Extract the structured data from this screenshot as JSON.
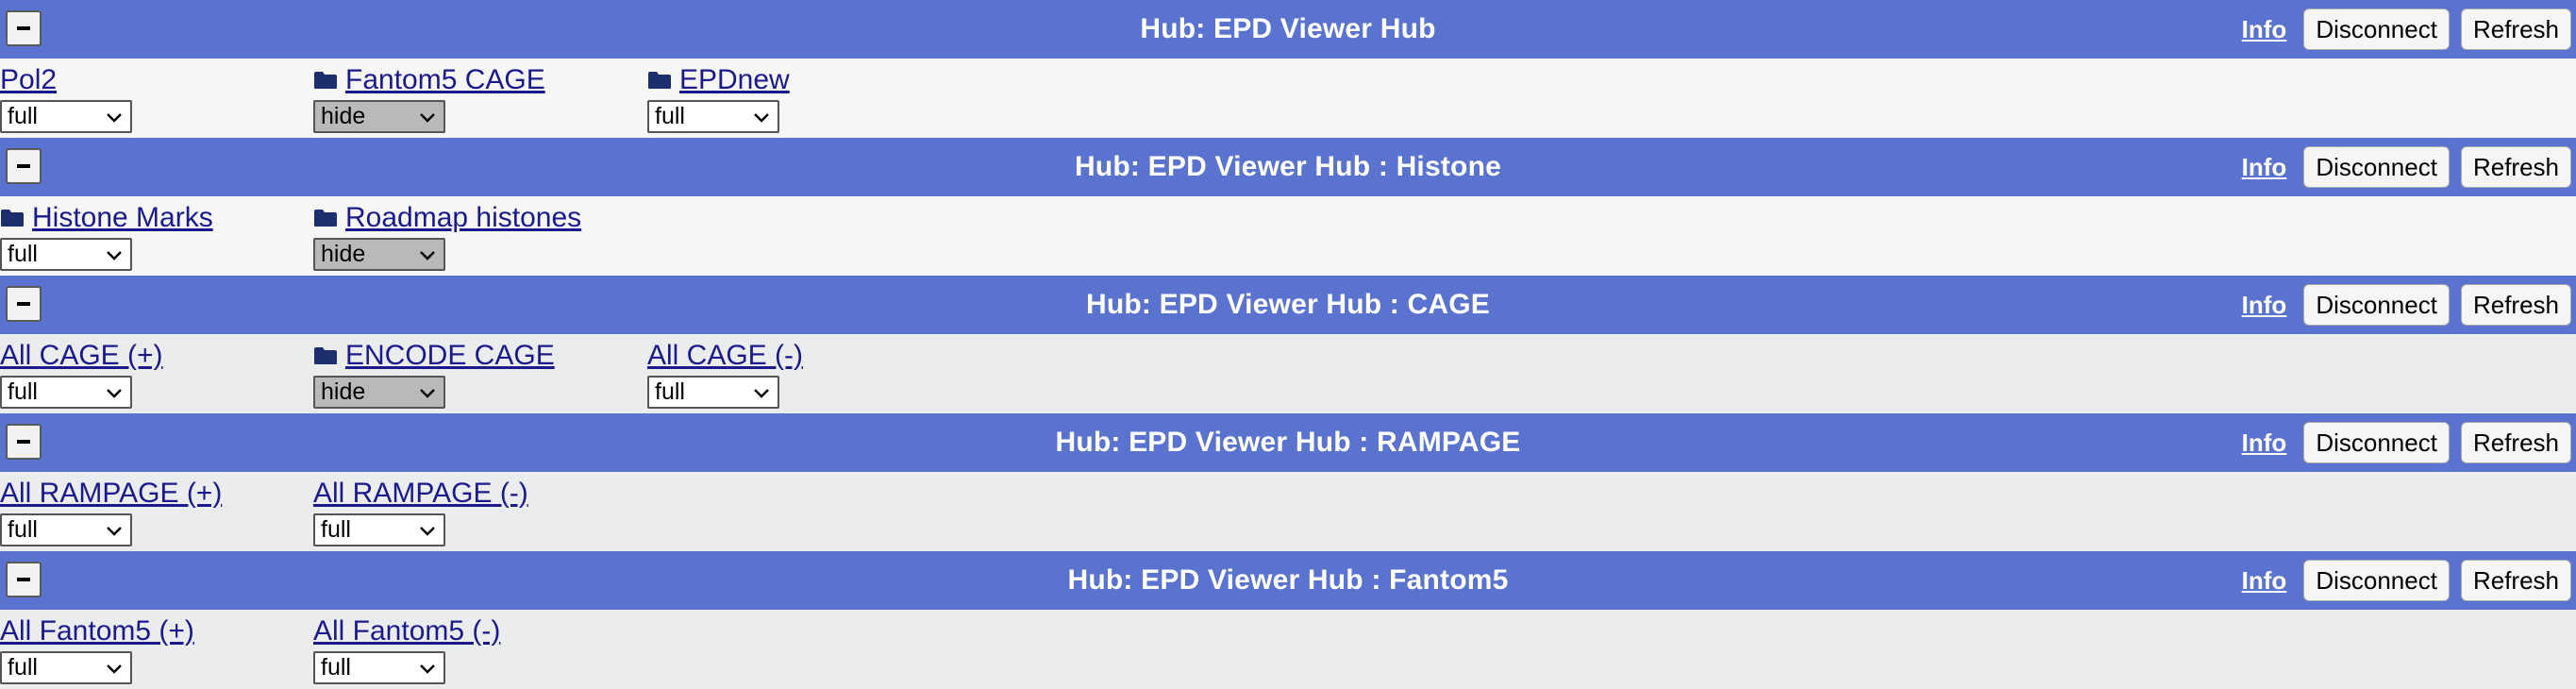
{
  "hubs": [
    {
      "title": "Hub: EPD Viewer Hub",
      "info": "Info",
      "disconnect": "Disconnect",
      "refresh": "Refresh",
      "tracks": [
        {
          "label": "Pol2",
          "folder": false,
          "visibility": "full"
        },
        {
          "label": "Fantom5 CAGE",
          "folder": true,
          "visibility": "hide"
        },
        {
          "label": "EPDnew",
          "folder": true,
          "visibility": "full"
        }
      ]
    },
    {
      "title": "Hub: EPD Viewer Hub : Histone",
      "info": "Info",
      "disconnect": "Disconnect",
      "refresh": "Refresh",
      "tracks": [
        {
          "label": "Histone Marks",
          "folder": true,
          "visibility": "full"
        },
        {
          "label": "Roadmap histones",
          "folder": true,
          "visibility": "hide"
        }
      ]
    },
    {
      "title": "Hub: EPD Viewer Hub : CAGE",
      "info": "Info",
      "disconnect": "Disconnect",
      "refresh": "Refresh",
      "tracks": [
        {
          "label": "All CAGE (+)",
          "folder": false,
          "visibility": "full"
        },
        {
          "label": "ENCODE CAGE",
          "folder": true,
          "visibility": "hide"
        },
        {
          "label": "All CAGE (-)",
          "folder": false,
          "visibility": "full"
        }
      ]
    },
    {
      "title": "Hub: EPD Viewer Hub : RAMPAGE",
      "info": "Info",
      "disconnect": "Disconnect",
      "refresh": "Refresh",
      "tracks": [
        {
          "label": "All RAMPAGE (+)",
          "folder": false,
          "visibility": "full"
        },
        {
          "label": "All RAMPAGE (-)",
          "folder": false,
          "visibility": "full"
        }
      ]
    },
    {
      "title": "Hub: EPD Viewer Hub : Fantom5",
      "info": "Info",
      "disconnect": "Disconnect",
      "refresh": "Refresh",
      "tracks": [
        {
          "label": "All Fantom5 (+)",
          "folder": false,
          "visibility": "full"
        },
        {
          "label": "All Fantom5 (-)",
          "folder": false,
          "visibility": "full"
        }
      ]
    }
  ],
  "colors": {
    "header_bg": "#5a73ce",
    "link": "#1a1a8c",
    "hide_select_bg": "#b9b9b9"
  },
  "icons": {
    "collapse": "minus-icon",
    "folder": "folder-icon",
    "dropdown": "chevron-down-icon"
  }
}
